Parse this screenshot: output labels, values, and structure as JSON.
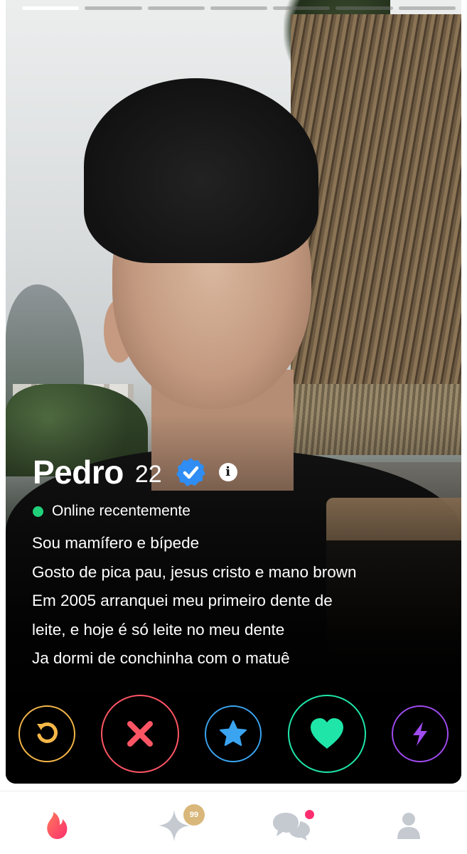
{
  "photo": {
    "count": 7,
    "active_index": 0
  },
  "profile": {
    "name": "Pedro",
    "age": "22",
    "status": "Online recentemente",
    "bio": [
      "Sou mamífero e bípede",
      "Gosto de pica pau, jesus cristo e mano brown",
      "Em 2005 arranquei meu primeiro dente de",
      "leite, e hoje é só leite no meu dente",
      "Ja dormi de conchinha com o matuê"
    ],
    "info_icon_glyph": "i"
  },
  "actions": {
    "rewind": "rewind-icon",
    "nope": "x-icon",
    "super_like": "star-icon",
    "like": "heart-icon",
    "boost": "lightning-icon"
  },
  "nav": {
    "explore_badge": "99",
    "items": [
      "flame-icon",
      "sparkle-icon",
      "chat-icon",
      "profile-icon"
    ]
  },
  "colors": {
    "rewind": "#f5b748",
    "nope": "#fd5564",
    "super_like": "#3aa4f0",
    "like": "#1fe6a8",
    "boost": "#a04bf0",
    "online": "#21d07a",
    "verified": "#2f8df3",
    "nav_active": "#fd3f6a",
    "nav_inactive": "#c5cad1"
  }
}
